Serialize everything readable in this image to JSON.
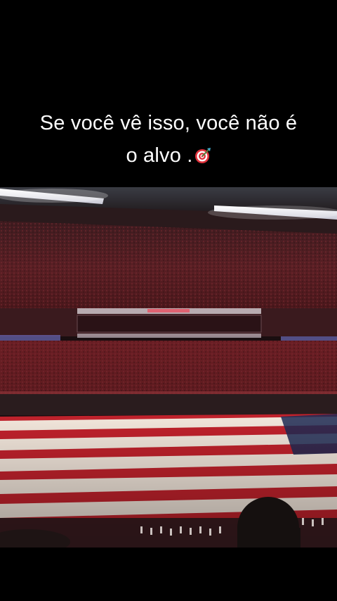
{
  "caption": {
    "line1": "Se você vê isso, você não é",
    "line2": "o alvo ."
  },
  "icons": {
    "caption_emoji": "direct-hit-target-icon"
  },
  "video": {
    "scene": "stadium-field-flag"
  }
}
